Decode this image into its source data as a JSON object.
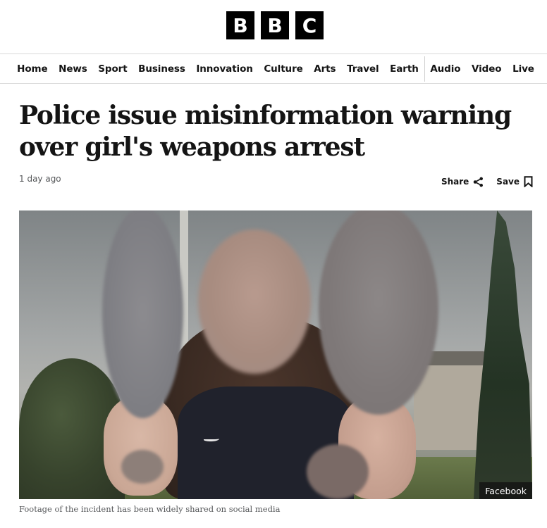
{
  "logo": {
    "letters": [
      "B",
      "B",
      "C"
    ]
  },
  "nav": {
    "primary": [
      "Home",
      "News",
      "Sport",
      "Business",
      "Innovation",
      "Culture",
      "Arts",
      "Travel",
      "Earth"
    ],
    "secondary": [
      "Audio",
      "Video",
      "Live"
    ]
  },
  "article": {
    "headline": "Police issue misinformation warning over girl's weapons arrest",
    "timestamp": "1 day ago",
    "share_label": "Share",
    "save_label": "Save",
    "share_icon": "share-icon",
    "save_icon": "bookmark-icon",
    "image": {
      "credit": "Facebook",
      "caption": "Footage of the incident has been widely shared on social media"
    }
  }
}
